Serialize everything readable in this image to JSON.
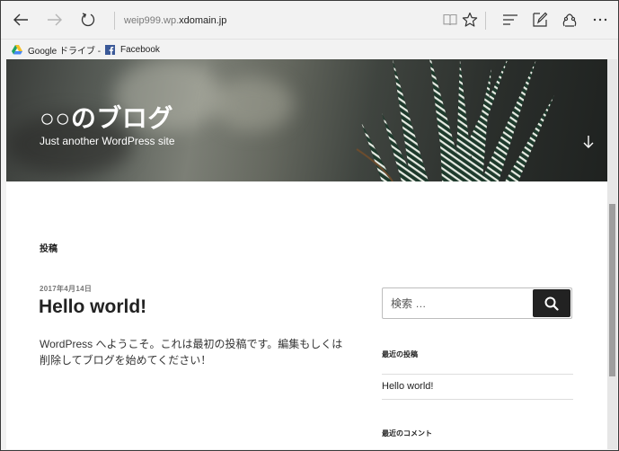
{
  "browser": {
    "address": {
      "prefix": "weip999.wp.",
      "domain": "xdomain.jp"
    },
    "favorites": [
      {
        "label": "Google ドライブ -",
        "icon": "google-drive-icon"
      },
      {
        "label": "Facebook",
        "icon": "facebook-icon"
      }
    ]
  },
  "site": {
    "title": "○○のブログ",
    "tagline": "Just another WordPress site"
  },
  "main": {
    "section_label": "投稿",
    "post": {
      "date": "2017年4月14日",
      "title": "Hello world!",
      "body": "WordPress へようこそ。これは最初の投稿です。編集もしくは削除してブログを始めてください！"
    }
  },
  "sidebar": {
    "search": {
      "placeholder": "検索 …"
    },
    "recent_posts": {
      "title": "最近の投稿",
      "items": [
        "Hello world!"
      ]
    },
    "recent_comments": {
      "title": "最近のコメント"
    }
  },
  "colors": {
    "search_button": "#222222",
    "chrome": "#f2f2f2"
  }
}
